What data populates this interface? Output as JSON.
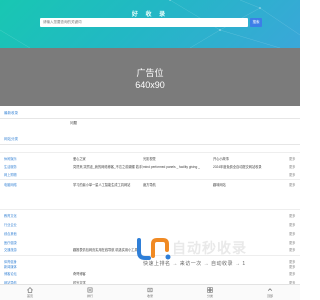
{
  "header": {
    "title": "好 收 录",
    "search_placeholder": "请输入您要查询的关键词",
    "search_button": "搜索"
  },
  "ad": {
    "line1": "广告位",
    "line2": "640x90"
  },
  "latest": {
    "heading": "最新收录",
    "item": "问题"
  },
  "category": {
    "heading": "网站分类",
    "rows": [
      {
        "cat": "休闲娱乐",
        "c1": "爱心之家",
        "c2": "光影视觉",
        "c3": "开心小故事",
        "more": "更多"
      },
      {
        "cat": "生活服务",
        "c1": "突然来,突然走_我的网络博客_不忘之前蝴蝶 若手漫画推",
        "c2": "mind performed panels _ facility giving _",
        "c3": "2024年度免费全自动提交网站收录",
        "more": "更多"
      },
      {
        "cat": "网上购物",
        "c1": "",
        "c2": "",
        "c3": "",
        "more": "更多"
      },
      {
        "cat": "电脑网络",
        "c1": "学习的最小单一星人工智能生成工具网站",
        "c2": "魔方导航",
        "c3": "趣味网站",
        "more": "更多"
      },
      {
        "cat": "教育文化",
        "c1": "",
        "c2": "",
        "c3": "",
        "more": "更多"
      },
      {
        "cat": "行业企业",
        "c1": "",
        "c2": "",
        "c3": "",
        "more": "更多"
      },
      {
        "cat": "综合其他",
        "c1": "",
        "c2": "",
        "c3": "",
        "more": "更多"
      },
      {
        "cat": "医疗健康",
        "c1": "",
        "c2": "",
        "c3": "",
        "more": "更多"
      },
      {
        "cat": "交通旅游",
        "c1": "趣推表情包网页实用在线导航 精选实用小工具",
        "c2": "",
        "c3": "",
        "more": "更多"
      },
      {
        "cat": "体育健身",
        "c1": "",
        "c2": "",
        "c3": "",
        "more": "更多"
      },
      {
        "cat": "新闻媒体",
        "c1": "",
        "c2": "",
        "c3": "",
        "more": "更多"
      },
      {
        "cat": "博客论坛",
        "c1": "奇哥博客",
        "c2": "",
        "c3": "",
        "more": "更多"
      },
      {
        "cat": "网站导航",
        "c1": "时光文学",
        "c2": "",
        "c3": "",
        "more": "更多"
      }
    ]
  },
  "watermark": {
    "title": "自动秒收录",
    "subtitle": "快速上排名 → 来访一次 → 自动收录 → 1"
  },
  "tabbar": {
    "items": [
      {
        "label": "首页",
        "icon": "home-icon"
      },
      {
        "label": "排行",
        "icon": "ranking-icon"
      },
      {
        "label": "收录",
        "icon": "submit-icon"
      },
      {
        "label": "分类",
        "icon": "category-icon"
      },
      {
        "label": "顶部",
        "icon": "top-icon"
      }
    ]
  },
  "colors": {
    "hero_start": "#18c7b2",
    "hero_end": "#3aa7d9",
    "accent": "#3b86d6",
    "search_button": "#3d7ee8",
    "ad_background": "#7b7b7b"
  }
}
